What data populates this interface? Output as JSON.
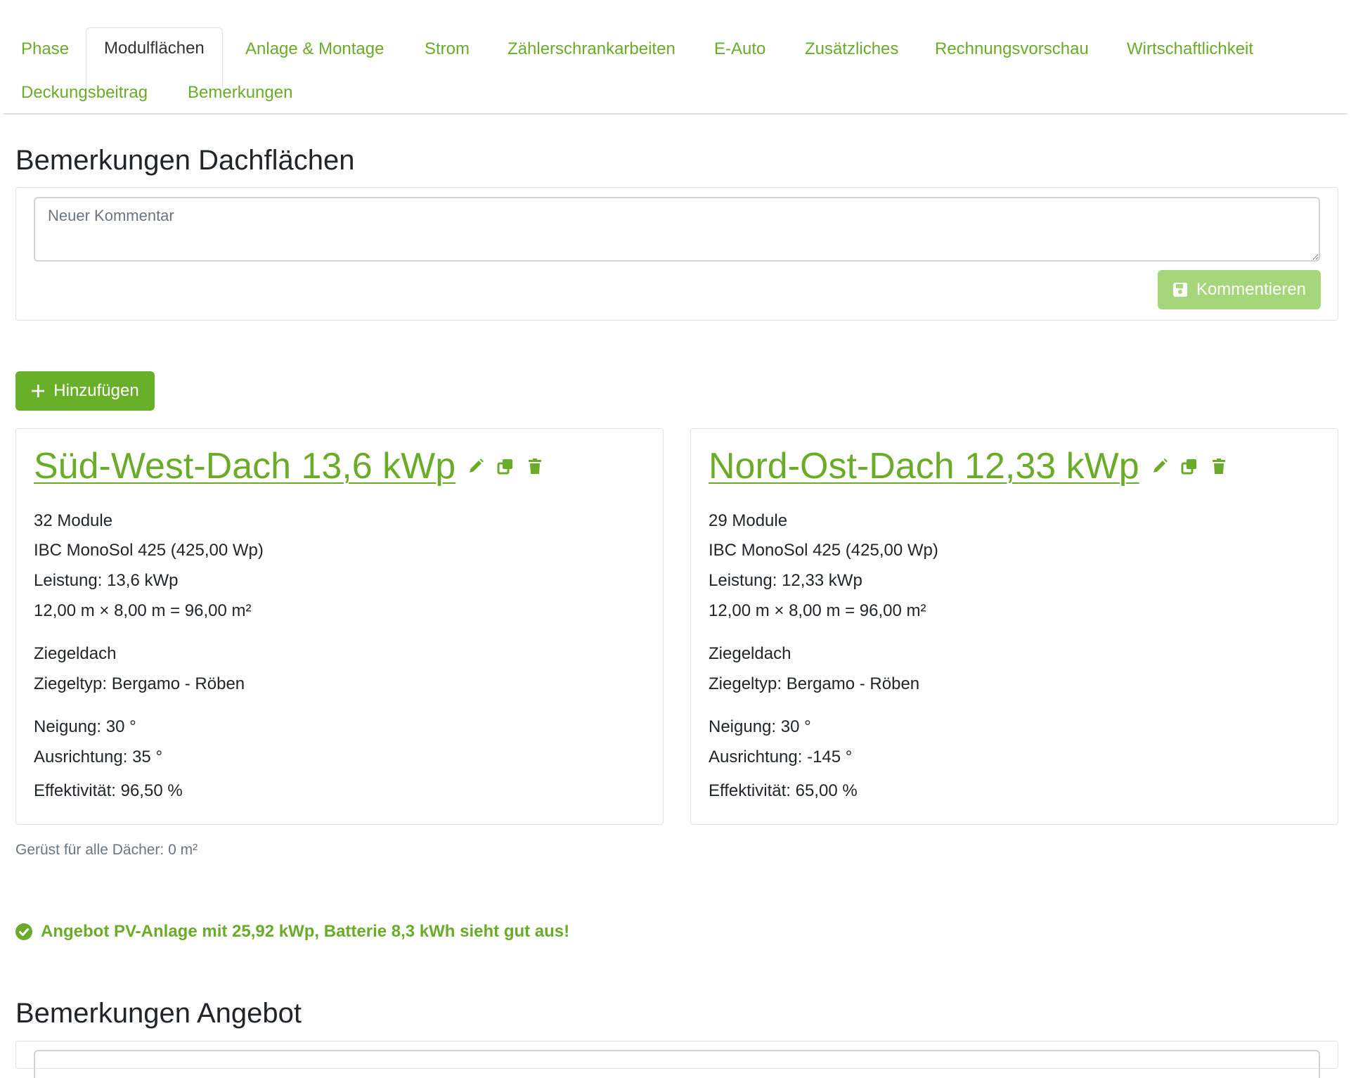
{
  "tabs": [
    {
      "label": "Phase",
      "active": false
    },
    {
      "label": "Modulflächen",
      "active": true
    },
    {
      "label": "Anlage & Montage",
      "active": false
    },
    {
      "label": "Strom",
      "active": false
    },
    {
      "label": "Zählerschrankarbeiten",
      "active": false
    },
    {
      "label": "E-Auto",
      "active": false
    },
    {
      "label": "Zusätzliches",
      "active": false
    },
    {
      "label": "Rechnungsvorschau",
      "active": false
    },
    {
      "label": "Wirtschaftlichkeit",
      "active": false
    },
    {
      "label": "Deckungsbeitrag",
      "active": false
    },
    {
      "label": "Bemerkungen",
      "active": false
    }
  ],
  "roof_comments": {
    "title": "Bemerkungen Dachflächen",
    "placeholder": "Neuer Kommentar",
    "submit_label": "Kommentieren",
    "submit_icon": "save-icon"
  },
  "add_button": {
    "label": "Hinzufügen",
    "icon": "plus-icon"
  },
  "cards": [
    {
      "title": "Süd-West-Dach 13,6 kWp",
      "modules": "32 Module",
      "module_type": "IBC MonoSol 425 (425,00 Wp)",
      "power": "Leistung: 13,6 kWp",
      "area": "12,00 m × 8,00 m = 96,00 m²",
      "roof_type": "Ziegeldach",
      "tile_type": "Ziegeltyp: Bergamo - Röben",
      "tilt": "Neigung: 30 °",
      "orientation": "Ausrichtung: 35 °",
      "efficiency": "Effektivität: 96,50 %"
    },
    {
      "title": "Nord-Ost-Dach 12,33 kWp",
      "modules": "29 Module",
      "module_type": "IBC MonoSol 425 (425,00 Wp)",
      "power": "Leistung: 12,33 kWp",
      "area": "12,00 m × 8,00 m = 96,00 m²",
      "roof_type": "Ziegeldach",
      "tile_type": "Ziegeltyp: Bergamo - Röben",
      "tilt": "Neigung: 30 °",
      "orientation": "Ausrichtung: -145 °",
      "efficiency": "Effektivität: 65,00 %"
    }
  ],
  "card_actions": [
    "edit-icon",
    "copy-icon",
    "trash-icon"
  ],
  "scaffold_note": "Gerüst für alle Dächer: 0 m²",
  "status_message": "Angebot PV-Anlage mit 25,92 kWp, Batterie 8,3 kWh sieht gut aus!",
  "offer_comments": {
    "title": "Bemerkungen Angebot"
  },
  "colors": {
    "accent": "#6aab2a",
    "button": "#69b02a",
    "button_disabled": "#a5d67a",
    "border": "#dee2e6"
  }
}
